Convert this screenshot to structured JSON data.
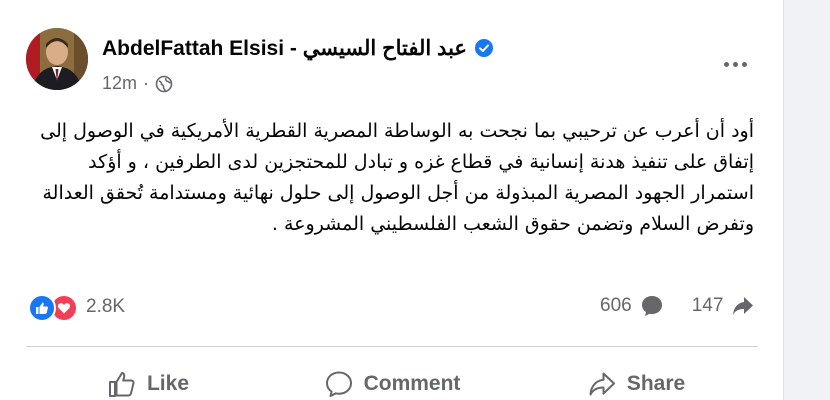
{
  "post": {
    "author": "AbdelFattah Elsisi - عبد الفتاح السيسي",
    "time": "12m",
    "separator": "·",
    "privacy_icon": "globe-icon",
    "verified_icon": "verified-badge-icon",
    "more_icon": "more-options-icon",
    "text": "أود أن أعرب عن ترحيبي بما نجحت به الوساطة المصرية القطرية الأمريكية في الوصول إلى إتفاق على تنفيذ هدنة إنسانية في قطاع غزه و تبادل للمحتجزين لدى الطرفين ، و أؤكد استمرار الجهود المصرية المبذولة من أجل الوصول إلى حلول نهائية ومستدامة تُحقق العدالة وتفرض السلام وتضمن حقوق الشعب الفلسطيني المشروعة ."
  },
  "stats": {
    "reactions_count": "2.8K",
    "reaction_icons": [
      "like-reaction-icon",
      "love-reaction-icon"
    ],
    "comments_count": "606",
    "shares_count": "147"
  },
  "actions": {
    "like_label": "Like",
    "comment_label": "Comment",
    "share_label": "Share"
  },
  "colors": {
    "accent": "#1877f2",
    "love": "#f33e58",
    "secondary_text": "#65676b",
    "primary_text": "#050505"
  }
}
